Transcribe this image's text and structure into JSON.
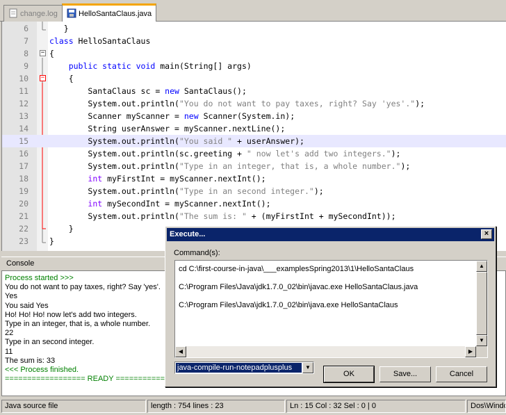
{
  "tabs": [
    {
      "label": "change.log",
      "active": false
    },
    {
      "label": "HelloSantaClaus.java",
      "active": true
    }
  ],
  "editor": {
    "current_line": 15,
    "lines": [
      {
        "n": "6",
        "html_parts": [
          {
            "t": "   }",
            "c": ""
          }
        ]
      },
      {
        "n": "7",
        "html_parts": [
          {
            "t": "class",
            "c": "kw"
          },
          {
            "t": " HelloSantaClaus",
            "c": ""
          }
        ]
      },
      {
        "n": "8",
        "html_parts": [
          {
            "t": "{",
            "c": ""
          }
        ]
      },
      {
        "n": "9",
        "html_parts": [
          {
            "t": "    ",
            "c": ""
          },
          {
            "t": "public static void",
            "c": "kw"
          },
          {
            "t": " main(String[] args)",
            "c": ""
          }
        ]
      },
      {
        "n": "10",
        "html_parts": [
          {
            "t": "    {",
            "c": ""
          }
        ]
      },
      {
        "n": "11",
        "html_parts": [
          {
            "t": "        SantaClaus sc = ",
            "c": ""
          },
          {
            "t": "new",
            "c": "kw"
          },
          {
            "t": " SantaClaus();",
            "c": ""
          }
        ]
      },
      {
        "n": "12",
        "html_parts": [
          {
            "t": "        System.out.println(",
            "c": ""
          },
          {
            "t": "\"You do not want to pay taxes, right? Say 'yes'.\"",
            "c": "str"
          },
          {
            "t": ");",
            "c": ""
          }
        ]
      },
      {
        "n": "13",
        "html_parts": [
          {
            "t": "        Scanner myScanner = ",
            "c": ""
          },
          {
            "t": "new",
            "c": "kw"
          },
          {
            "t": " Scanner(System.in);",
            "c": ""
          }
        ]
      },
      {
        "n": "14",
        "html_parts": [
          {
            "t": "        String userAnswer = myScanner.nextLine();",
            "c": ""
          }
        ]
      },
      {
        "n": "15",
        "html_parts": [
          {
            "t": "        System.out.println(",
            "c": ""
          },
          {
            "t": "\"You said \"",
            "c": "str"
          },
          {
            "t": " + userAnswer);",
            "c": ""
          }
        ]
      },
      {
        "n": "16",
        "html_parts": [
          {
            "t": "        System.out.println(sc.greeting + ",
            "c": ""
          },
          {
            "t": "\" now let's add two integers.\"",
            "c": "str"
          },
          {
            "t": ");",
            "c": ""
          }
        ]
      },
      {
        "n": "17",
        "html_parts": [
          {
            "t": "        System.out.println(",
            "c": ""
          },
          {
            "t": "\"Type in an integer, that is, a whole number.\"",
            "c": "str"
          },
          {
            "t": ");",
            "c": ""
          }
        ]
      },
      {
        "n": "18",
        "html_parts": [
          {
            "t": "        ",
            "c": ""
          },
          {
            "t": "int",
            "c": "ty"
          },
          {
            "t": " myFirstInt = myScanner.nextInt();",
            "c": ""
          }
        ]
      },
      {
        "n": "19",
        "html_parts": [
          {
            "t": "        System.out.println(",
            "c": ""
          },
          {
            "t": "\"Type in an second integer.\"",
            "c": "str"
          },
          {
            "t": ");",
            "c": ""
          }
        ]
      },
      {
        "n": "20",
        "html_parts": [
          {
            "t": "        ",
            "c": ""
          },
          {
            "t": "int",
            "c": "ty"
          },
          {
            "t": " mySecondInt = myScanner.nextInt();",
            "c": ""
          }
        ]
      },
      {
        "n": "21",
        "html_parts": [
          {
            "t": "        System.out.println(",
            "c": ""
          },
          {
            "t": "\"The sum is: \"",
            "c": "str"
          },
          {
            "t": " + (myFirstInt + mySecondInt));",
            "c": ""
          }
        ]
      },
      {
        "n": "22",
        "html_parts": [
          {
            "t": "    }",
            "c": ""
          }
        ]
      },
      {
        "n": "23",
        "html_parts": [
          {
            "t": "}",
            "c": ""
          }
        ]
      }
    ]
  },
  "console": {
    "title": "Console",
    "lines": [
      {
        "text": "Process started >>>",
        "green": true
      },
      {
        "text": "You do not want to pay taxes, right? Say 'yes'.",
        "green": false
      },
      {
        "text": "Yes",
        "green": false
      },
      {
        "text": "You said Yes",
        "green": false
      },
      {
        "text": "Ho! Ho! Ho! now let's add two integers.",
        "green": false
      },
      {
        "text": "Type in an integer, that is, a whole number.",
        "green": false
      },
      {
        "text": "22",
        "green": false
      },
      {
        "text": "Type in an second integer.",
        "green": false
      },
      {
        "text": "11",
        "green": false
      },
      {
        "text": "The sum is: 33",
        "green": false
      },
      {
        "text": "<<< Process finished.",
        "green": true
      },
      {
        "text": "================== READY ==================",
        "green": true
      }
    ]
  },
  "status": {
    "filetype": "Java source file",
    "length": "length : 754    lines : 23",
    "position": "Ln : 15    Col : 32    Sel : 0 | 0",
    "eol": "Dos\\Windows"
  },
  "dialog": {
    "title": "Execute...",
    "close": "×",
    "label": "Command(s):",
    "commands": [
      "cd C:\\first-course-in-java\\___examplesSpring2013\\1\\HelloSantaClaus",
      "C:\\Program Files\\Java\\jdk1.7.0_02\\bin\\javac.exe HelloSantaClaus.java",
      "C:\\Program Files\\Java\\jdk1.7.0_02\\bin\\java.exe HelloSantaClaus"
    ],
    "script_name": "java-compile-run-notepadplusplus",
    "ok": "OK",
    "save": "Save...",
    "cancel": "Cancel"
  }
}
